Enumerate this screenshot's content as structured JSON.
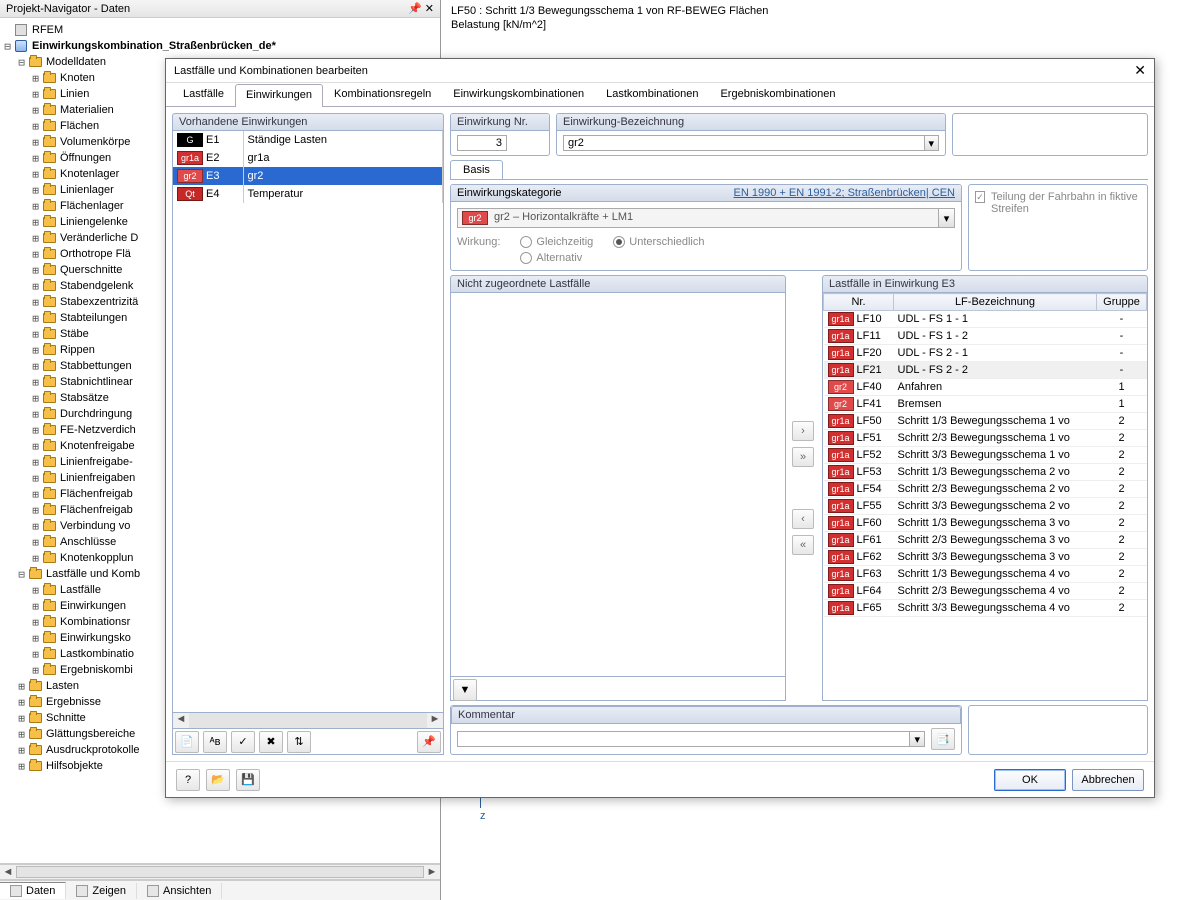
{
  "navigator": {
    "title": "Projekt-Navigator - Daten",
    "root_app": "RFEM",
    "project": "Einwirkungskombination_Straßenbrücken_de*",
    "groups": [
      {
        "label": "Modelldaten",
        "expanded": true,
        "children": [
          "Knoten",
          "Linien",
          "Materialien",
          "Flächen",
          "Volumenkörpe",
          "Öffnungen",
          "Knotenlager",
          "Linienlager",
          "Flächenlager",
          "Liniengelenke",
          "Veränderliche D",
          "Orthotrope Flä",
          "Querschnitte",
          "Stabendgelenk",
          "Stabexzentrizitä",
          "Stabteilungen",
          "Stäbe",
          "Rippen",
          "Stabbettungen",
          "Stabnichtlinear",
          "Stabsätze",
          "Durchdringung",
          "FE-Netzverdich",
          "Knotenfreigabe",
          "Linienfreigabe-",
          "Linienfreigaben",
          "Flächenfreigab",
          "Flächenfreigab",
          "Verbindung vo",
          "Anschlüsse",
          "Knotenkopplun"
        ]
      },
      {
        "label": "Lastfälle und Komb",
        "expanded": true,
        "children": [
          "Lastfälle",
          "Einwirkungen",
          "Kombinationsr",
          "Einwirkungsko",
          "Lastkombinatio",
          "Ergebniskombi"
        ]
      },
      {
        "label": "Lasten",
        "expanded": false
      },
      {
        "label": "Ergebnisse",
        "expanded": false
      },
      {
        "label": "Schnitte",
        "expanded": false
      },
      {
        "label": "Glättungsbereiche",
        "expanded": false
      },
      {
        "label": "Ausdruckprotokolle",
        "expanded": false
      },
      {
        "label": "Hilfsobjekte",
        "expanded": false
      }
    ],
    "tabs": [
      "Daten",
      "Zeigen",
      "Ansichten"
    ]
  },
  "main": {
    "header_line1": "LF50 : Schritt 1/3 Bewegungsschema 1 von RF-BEWEG Flächen",
    "header_line2": "Belastung [kN/m^2]",
    "z_label": "z"
  },
  "dialog": {
    "title": "Lastfälle und Kombinationen bearbeiten",
    "tabs": [
      "Lastfälle",
      "Einwirkungen",
      "Kombinationsregeln",
      "Einwirkungskombinationen",
      "Lastkombinationen",
      "Ergebniskombinationen"
    ],
    "active_tab": 1,
    "actions_header": "Vorhandene Einwirkungen",
    "actions": [
      {
        "tag": "G",
        "tagClass": "G",
        "code": "E1",
        "name": "Ständige Lasten",
        "sel": false
      },
      {
        "tag": "gr1a",
        "tagClass": "gr1a",
        "code": "E2",
        "name": "gr1a",
        "sel": false
      },
      {
        "tag": "gr2",
        "tagClass": "gr2",
        "code": "E3",
        "name": "gr2",
        "sel": true
      },
      {
        "tag": "Qt",
        "tagClass": "Qt",
        "code": "E4",
        "name": "Temperatur",
        "sel": false
      }
    ],
    "einwirkung_nr_label": "Einwirkung Nr.",
    "einwirkung_nr": "3",
    "bezeichnung_label": "Einwirkung-Bezeichnung",
    "bezeichnung": "gr2",
    "basis_tab": "Basis",
    "category_label": "Einwirkungskategorie",
    "category_link": "EN 1990 + EN 1991-2; Straßenbrücken| CEN",
    "category_tag": "gr2",
    "category_value": "gr2 – Horizontalkräfte + LM1",
    "wirkung_label": "Wirkung:",
    "wirkung_options": [
      "Gleichzeitig",
      "Alternativ",
      "Unterschiedlich"
    ],
    "wirkung_selected": 2,
    "teilung_label": "Teilung der Fahrbahn in fiktive Streifen",
    "unassigned_label": "Nicht zugeordnete Lastfälle",
    "assigned_label": "Lastfälle in Einwirkung E3",
    "col_nr": "Nr.",
    "col_bez": "LF-Bezeichnung",
    "col_grp": "Gruppe",
    "loadcases": [
      {
        "tag": "gr1a",
        "nr": "LF10",
        "bez": "UDL - FS 1 - 1",
        "grp": "-"
      },
      {
        "tag": "gr1a",
        "nr": "LF11",
        "bez": "UDL - FS 1 - 2",
        "grp": "-"
      },
      {
        "tag": "gr1a",
        "nr": "LF20",
        "bez": "UDL - FS 2 - 1",
        "grp": "-"
      },
      {
        "tag": "gr1a",
        "nr": "LF21",
        "bez": "UDL - FS 2 - 2",
        "grp": "-",
        "hl": true
      },
      {
        "tag": "gr2",
        "nr": "LF40",
        "bez": "Anfahren",
        "grp": "1"
      },
      {
        "tag": "gr2",
        "nr": "LF41",
        "bez": "Bremsen",
        "grp": "1"
      },
      {
        "tag": "gr1a",
        "nr": "LF50",
        "bez": "Schritt 1/3 Bewegungsschema 1 vo",
        "grp": "2"
      },
      {
        "tag": "gr1a",
        "nr": "LF51",
        "bez": "Schritt 2/3 Bewegungsschema 1 vo",
        "grp": "2"
      },
      {
        "tag": "gr1a",
        "nr": "LF52",
        "bez": "Schritt 3/3 Bewegungsschema 1 vo",
        "grp": "2"
      },
      {
        "tag": "gr1a",
        "nr": "LF53",
        "bez": "Schritt 1/3 Bewegungsschema 2 vo",
        "grp": "2"
      },
      {
        "tag": "gr1a",
        "nr": "LF54",
        "bez": "Schritt 2/3 Bewegungsschema 2 vo",
        "grp": "2"
      },
      {
        "tag": "gr1a",
        "nr": "LF55",
        "bez": "Schritt 3/3 Bewegungsschema 2 vo",
        "grp": "2"
      },
      {
        "tag": "gr1a",
        "nr": "LF60",
        "bez": "Schritt 1/3 Bewegungsschema 3 vo",
        "grp": "2"
      },
      {
        "tag": "gr1a",
        "nr": "LF61",
        "bez": "Schritt 2/3 Bewegungsschema 3 vo",
        "grp": "2"
      },
      {
        "tag": "gr1a",
        "nr": "LF62",
        "bez": "Schritt 3/3 Bewegungsschema 3 vo",
        "grp": "2"
      },
      {
        "tag": "gr1a",
        "nr": "LF63",
        "bez": "Schritt 1/3 Bewegungsschema 4 vo",
        "grp": "2"
      },
      {
        "tag": "gr1a",
        "nr": "LF64",
        "bez": "Schritt 2/3 Bewegungsschema 4 vo",
        "grp": "2"
      },
      {
        "tag": "gr1a",
        "nr": "LF65",
        "bez": "Schritt 3/3 Bewegungsschema 4 vo",
        "grp": "2"
      }
    ],
    "kommentar_label": "Kommentar",
    "kommentar": "",
    "ok": "OK",
    "cancel": "Abbrechen"
  }
}
